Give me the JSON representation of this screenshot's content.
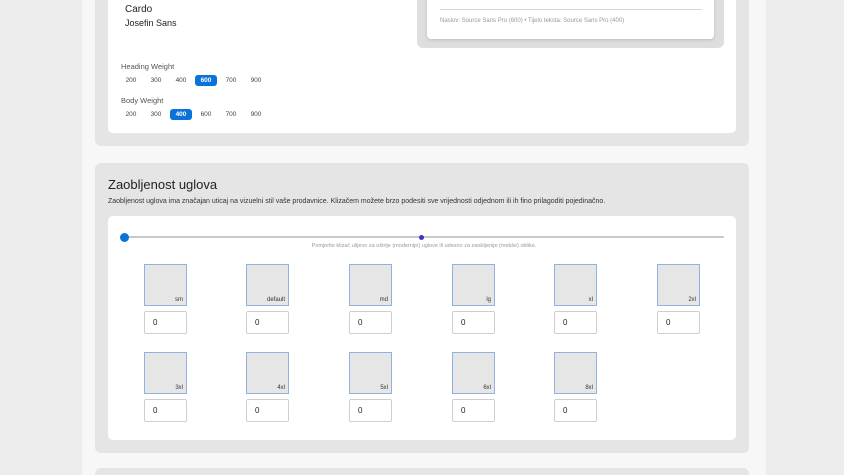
{
  "typography": {
    "fonts": [
      "Cardo",
      "Josefin Sans"
    ],
    "preview_text": "Naslov: Source Sans Pro (600) • Tijelo teksta: Source Sans Pro (400)",
    "heading_weight": {
      "label": "Heading Weight",
      "options": [
        "200",
        "300",
        "400",
        "600",
        "700",
        "900"
      ],
      "selected": "600"
    },
    "body_weight": {
      "label": "Body Weight",
      "options": [
        "200",
        "300",
        "400",
        "600",
        "700",
        "900"
      ],
      "selected": "400"
    }
  },
  "radius": {
    "title": "Zaobljenost uglova",
    "description": "Zaobljenost uglova ima značajan uticaj na vizuelni stil vaše prodavnice. Klizačem možete brzo podesiti sve vrijednosti odjednom ili ih fino prilagoditi pojedinačno.",
    "slider_hint": "Pomjerite klizač ulijevo za oštrije (modernije) uglove ili udesno za zaobljenije (mekše) oblike.",
    "slider_value_fraction": 0,
    "items": [
      {
        "label": "sm",
        "value": "0"
      },
      {
        "label": "default",
        "value": "0"
      },
      {
        "label": "md",
        "value": "0"
      },
      {
        "label": "lg",
        "value": "0"
      },
      {
        "label": "xl",
        "value": "0"
      },
      {
        "label": "2xl",
        "value": "0"
      },
      {
        "label": "3xl",
        "value": "0"
      },
      {
        "label": "4xl",
        "value": "0"
      },
      {
        "label": "5xl",
        "value": "0"
      },
      {
        "label": "6xl",
        "value": "0"
      },
      {
        "label": "8xl",
        "value": "0"
      }
    ]
  },
  "colors": {
    "accent": "#0b72d9",
    "slider_mid": "#3a35c8"
  }
}
